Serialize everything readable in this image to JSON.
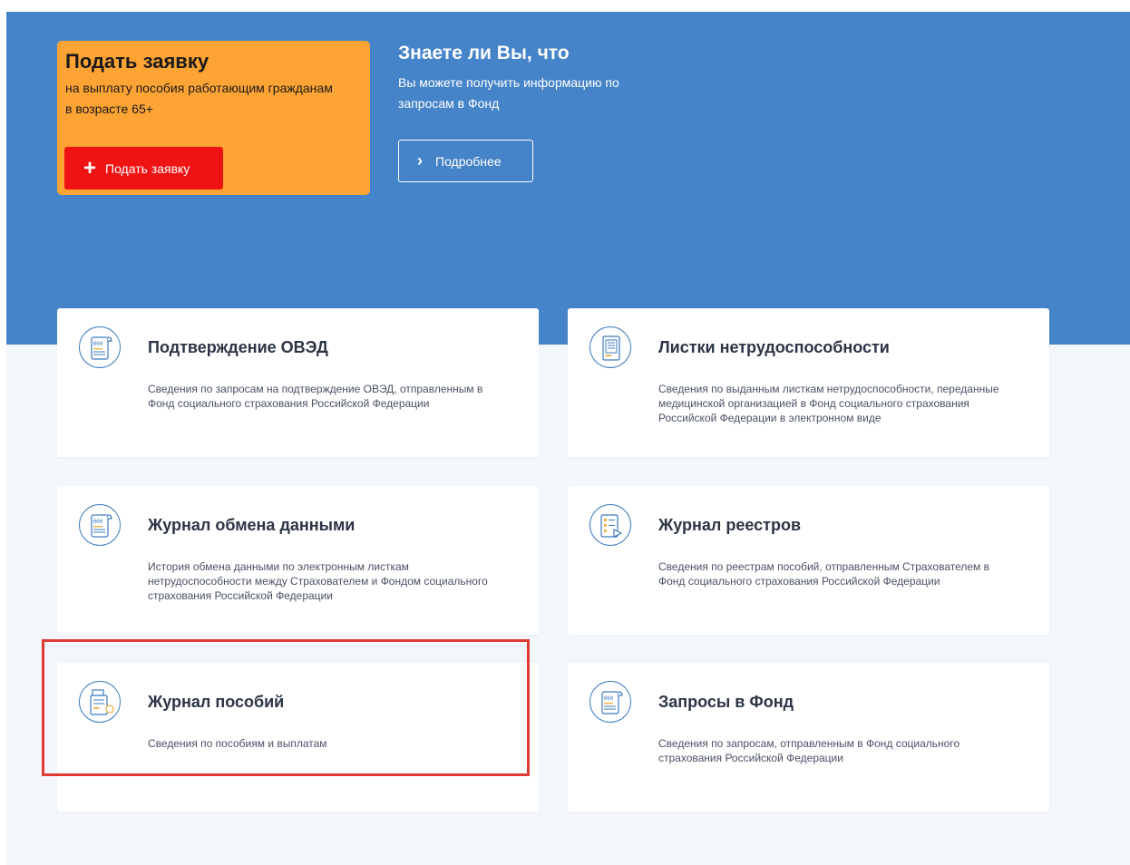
{
  "promo": {
    "title": "Подать заявку",
    "text": "на выплату пособия работающим гражданам в возрасте 65+",
    "button_label": "Подать заявку"
  },
  "info": {
    "title": "Знаете ли Вы, что",
    "text": "Вы можете получить информацию по запросам в Фонд",
    "button_label": "Подробнее"
  },
  "cards": [
    {
      "title": "Подтверждение ОВЭД",
      "desc": "Сведения по запросам на подтверждение ОВЭД, отправленным в Фонд социального страхования Российской Федерации",
      "icon": "scroll-document-icon"
    },
    {
      "title": "Листки нетрудоспособности",
      "desc": "Сведения по выданным листкам нетрудоспособности, переданные медицинской организацией в Фонд социального страхования Российской Федерации в электронном виде",
      "icon": "sick-leave-document-icon"
    },
    {
      "title": "Журнал обмена данными",
      "desc": "История обмена данными по электронным листкам нетрудоспособности между Страхователем и Фондом социального страхования Российской Федерации",
      "icon": "scroll-document-icon"
    },
    {
      "title": "Журнал реестров",
      "desc": "Сведения по реестрам пособий, отправленным Страхователем в Фонд социального страхования Российской Федерации",
      "icon": "registry-document-icon"
    },
    {
      "title": "Журнал пособий",
      "desc": "Сведения по пособиям и выплатам",
      "icon": "benefits-journal-icon"
    },
    {
      "title": "Запросы в Фонд",
      "desc": "Сведения по запросам, отправленным в Фонд социального страхования Российской Федерации",
      "icon": "scroll-document-icon"
    }
  ],
  "colors": {
    "hero_bg": "#4584c8",
    "page_bg": "#f3f6fa",
    "promo_bg": "#fea434",
    "promo_button": "#f01313",
    "highlight_border": "#e03a34",
    "icon_stroke": "#3d7cc0"
  }
}
